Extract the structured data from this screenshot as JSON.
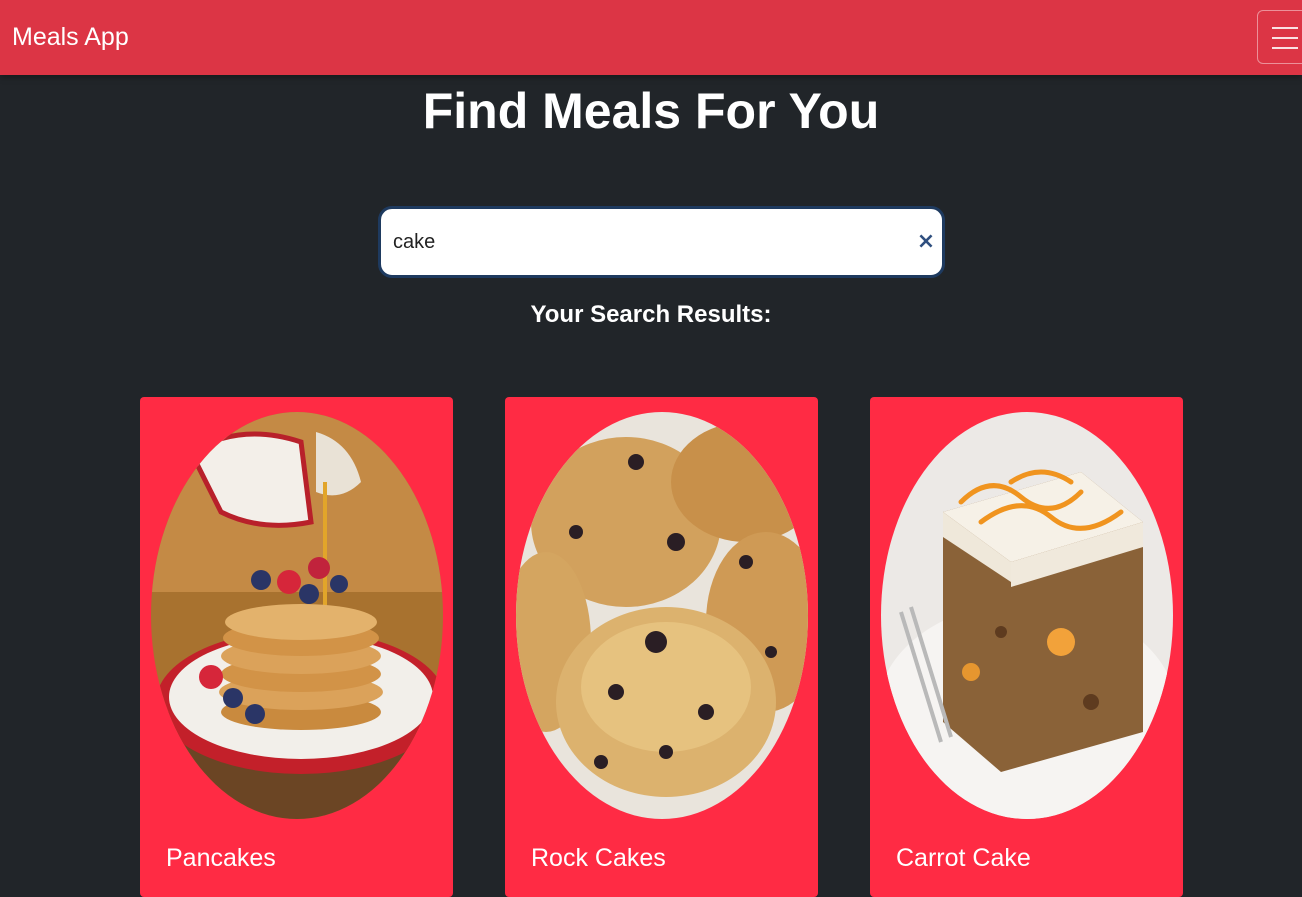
{
  "navbar": {
    "brand": "Meals App",
    "menu_icon": "hamburger-menu-icon",
    "color": "#dc3545"
  },
  "main": {
    "heading": "Find Meals For You",
    "search": {
      "value": "cake",
      "clear_label": "×"
    },
    "results_label": "Your Search Results:"
  },
  "results": [
    {
      "title": "Pancakes",
      "image": "pancakes-photo"
    },
    {
      "title": "Rock Cakes",
      "image": "rock-cakes-photo"
    },
    {
      "title": "Carrot Cake",
      "image": "carrot-cake-photo"
    }
  ],
  "colors": {
    "page_background": "#212529",
    "card": "#ff2b44"
  }
}
